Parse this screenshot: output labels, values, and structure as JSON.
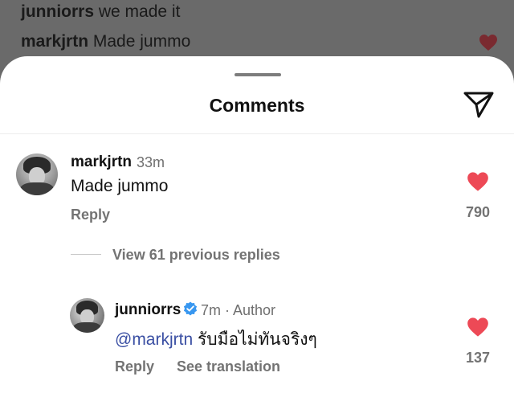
{
  "background_feed": {
    "lines": [
      {
        "username": "junniorrs",
        "text": "we made it"
      },
      {
        "username": "markjrtn",
        "text": "Made jummo"
      }
    ]
  },
  "sheet": {
    "title": "Comments",
    "share_icon": "send-icon"
  },
  "comments": [
    {
      "username": "markjrtn",
      "time": "33m",
      "text": "Made jummo",
      "reply_label": "Reply",
      "likes": "790",
      "liked": true
    }
  ],
  "thread": {
    "view_replies_label": "View 61 previous replies"
  },
  "replies": [
    {
      "username": "junniorrs",
      "verified": true,
      "time_meta": "7m · Author",
      "mention": "@markjrtn",
      "text": "รับมือไม่ทันจริงๆ",
      "reply_label": "Reply",
      "translation_label": "See translation",
      "likes": "137",
      "liked": true
    }
  ],
  "colors": {
    "like_red": "#ed4956",
    "mention_blue": "#3a4fa3",
    "verified_blue": "#3897f0",
    "secondary_gray": "#737373"
  }
}
